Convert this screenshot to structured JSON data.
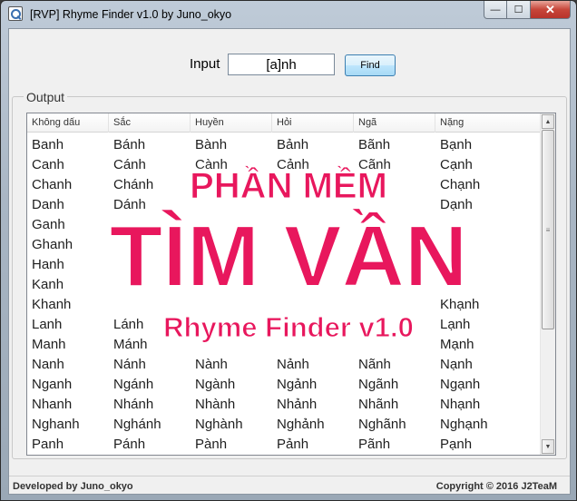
{
  "window": {
    "title": "[RVP] Rhyme Finder v1.0 by Juno_okyo",
    "minimize_glyph": "—",
    "maximize_glyph": "☐",
    "close_glyph": "✕"
  },
  "input": {
    "label": "Input",
    "value": "[a]nh",
    "find_label": "Find"
  },
  "output": {
    "legend": "Output",
    "columns": [
      "Không dấu",
      "Sắc",
      "Huyền",
      "Hỏi",
      "Ngã",
      "Nặng"
    ],
    "rows": [
      [
        "Banh",
        "Bánh",
        "Bành",
        "Bảnh",
        "Bãnh",
        "Bạnh"
      ],
      [
        "Canh",
        "Cánh",
        "Cành",
        "Cảnh",
        "Cãnh",
        "Cạnh"
      ],
      [
        "Chanh",
        "Chánh",
        "",
        "",
        "",
        "Chạnh"
      ],
      [
        "Danh",
        "Dánh",
        "",
        "",
        "",
        "Dạnh"
      ],
      [
        "Ganh",
        "",
        "",
        "",
        "",
        ""
      ],
      [
        "Ghanh",
        "",
        "",
        "",
        "",
        ""
      ],
      [
        "Hanh",
        "",
        "",
        "",
        "",
        ""
      ],
      [
        "Kanh",
        "",
        "",
        "",
        "",
        ""
      ],
      [
        "Khanh",
        "",
        "",
        "",
        "",
        "Khạnh"
      ],
      [
        "Lanh",
        "Lánh",
        "",
        "",
        "",
        "Lạnh"
      ],
      [
        "Manh",
        "Mánh",
        "",
        "",
        "",
        "Mạnh"
      ],
      [
        "Nanh",
        "Nánh",
        "Nành",
        "Nảnh",
        "Nãnh",
        "Nạnh"
      ],
      [
        "Nganh",
        "Ngánh",
        "Ngành",
        "Ngảnh",
        "Ngãnh",
        "Ngạnh"
      ],
      [
        "Nhanh",
        "Nhánh",
        "Nhành",
        "Nhảnh",
        "Nhãnh",
        "Nhạnh"
      ],
      [
        "Nghanh",
        "Nghánh",
        "Nghành",
        "Nghảnh",
        "Nghãnh",
        "Nghạnh"
      ],
      [
        "Panh",
        "Pánh",
        "Pành",
        "Pảnh",
        "Pãnh",
        "Pạnh"
      ]
    ]
  },
  "status": {
    "left": "Developed by Juno_okyo",
    "right": "Copyright © 2016 J2TeaM"
  },
  "overlay": {
    "line1": "PHẦN MỀM",
    "line2": "TÌM VẦN",
    "line3": "Rhyme Finder v1.0"
  },
  "colors": {
    "overlay_pink": "#e8175d",
    "find_button_border": "#3c7fb1",
    "close_button": "#c7463a"
  },
  "icons": {
    "app": "magnifier-icon",
    "scroll_up": "arrow-up-icon",
    "scroll_down": "arrow-down-icon"
  }
}
